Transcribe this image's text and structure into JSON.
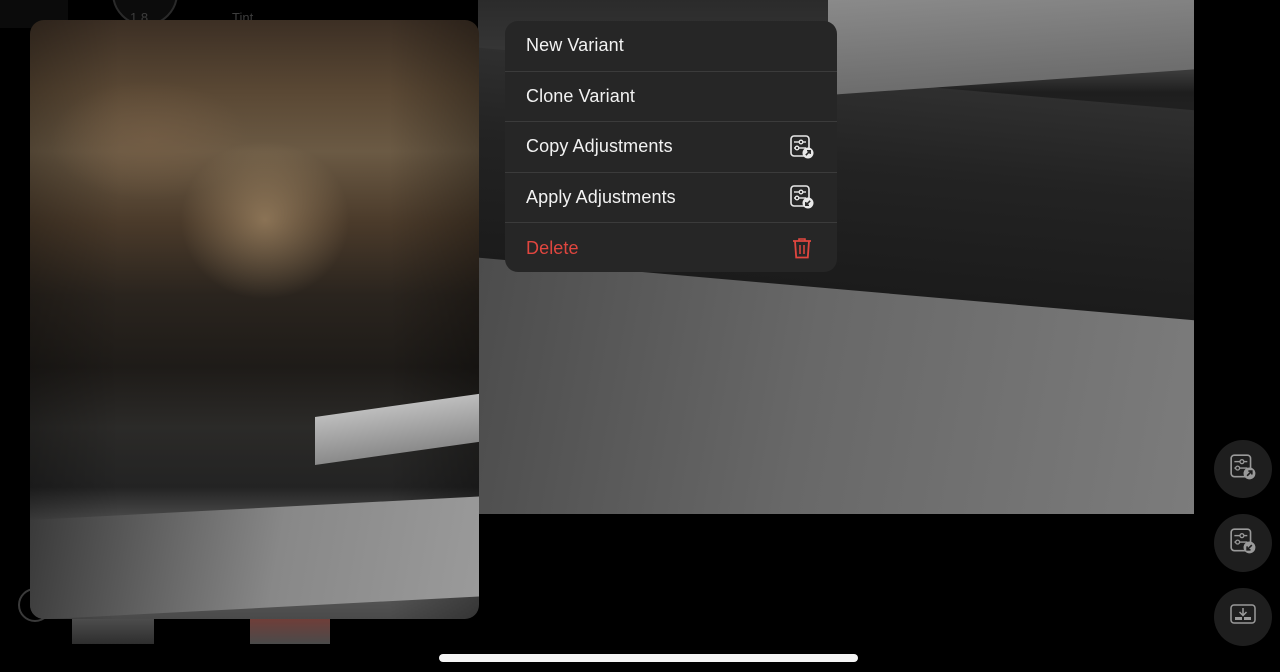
{
  "background": {
    "dial_value": "1.8",
    "tint_label": "Tint"
  },
  "context_menu": {
    "items": [
      {
        "label": "New Variant",
        "icon": null,
        "destructive": false
      },
      {
        "label": "Clone Variant",
        "icon": null,
        "destructive": false
      },
      {
        "label": "Copy Adjustments",
        "icon": "copy-adjustments-icon",
        "destructive": false
      },
      {
        "label": "Apply Adjustments",
        "icon": "apply-adjustments-icon",
        "destructive": false
      },
      {
        "label": "Delete",
        "icon": "trash-icon",
        "destructive": true
      }
    ],
    "destructive_color": "#e0463f"
  },
  "floating_buttons": [
    {
      "name": "copy-adjustments-button",
      "icon": "copy-adjustments-icon"
    },
    {
      "name": "apply-adjustments-button",
      "icon": "apply-adjustments-icon"
    },
    {
      "name": "export-button",
      "icon": "download-tray-icon"
    }
  ]
}
